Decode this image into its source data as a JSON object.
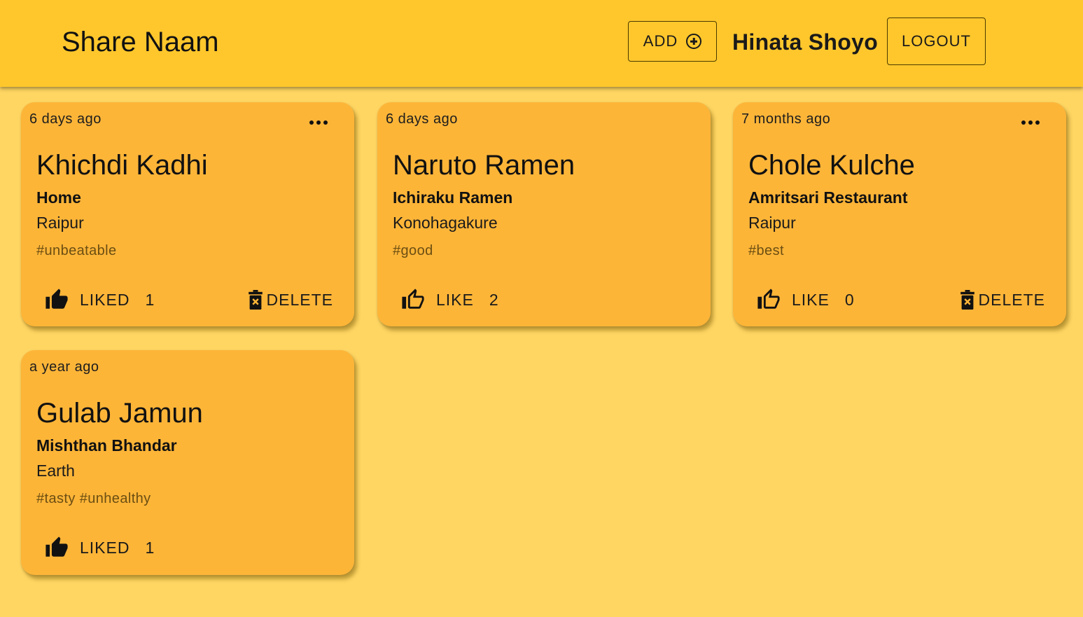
{
  "app": {
    "title": "Share Naam"
  },
  "header": {
    "add_label": "ADD",
    "username": "Hinata Shoyo",
    "logout_label": "LOGOUT"
  },
  "colors": {
    "appbar": "#ffc72c",
    "background": "#ffd662",
    "card": "#fdb538"
  },
  "posts": [
    {
      "time": "6 days ago",
      "title": "Khichdi Kadhi",
      "place": "Home",
      "city": "Raipur",
      "tags": "#unbeatable",
      "like_label": "LIKED",
      "like_count": "1",
      "liked": true,
      "has_menu": true,
      "delete_label": "DELETE"
    },
    {
      "time": "6 days ago",
      "title": "Naruto Ramen",
      "place": "Ichiraku Ramen",
      "city": "Konohagakure",
      "tags": "#good",
      "like_label": "LIKE",
      "like_count": "2",
      "liked": false,
      "has_menu": false
    },
    {
      "time": "7 months ago",
      "title": "Chole Kulche",
      "place": "Amritsari Restaurant",
      "city": "Raipur",
      "tags": "#best",
      "like_label": "LIKE",
      "like_count": "0",
      "liked": false,
      "has_menu": true,
      "delete_label": "DELETE"
    },
    {
      "time": "a year ago",
      "title": "Gulab Jamun",
      "place": "Mishthan Bhandar",
      "city": "Earth",
      "tags": "#tasty #unhealthy",
      "like_label": "LIKED",
      "like_count": "1",
      "liked": true,
      "has_menu": false
    }
  ]
}
